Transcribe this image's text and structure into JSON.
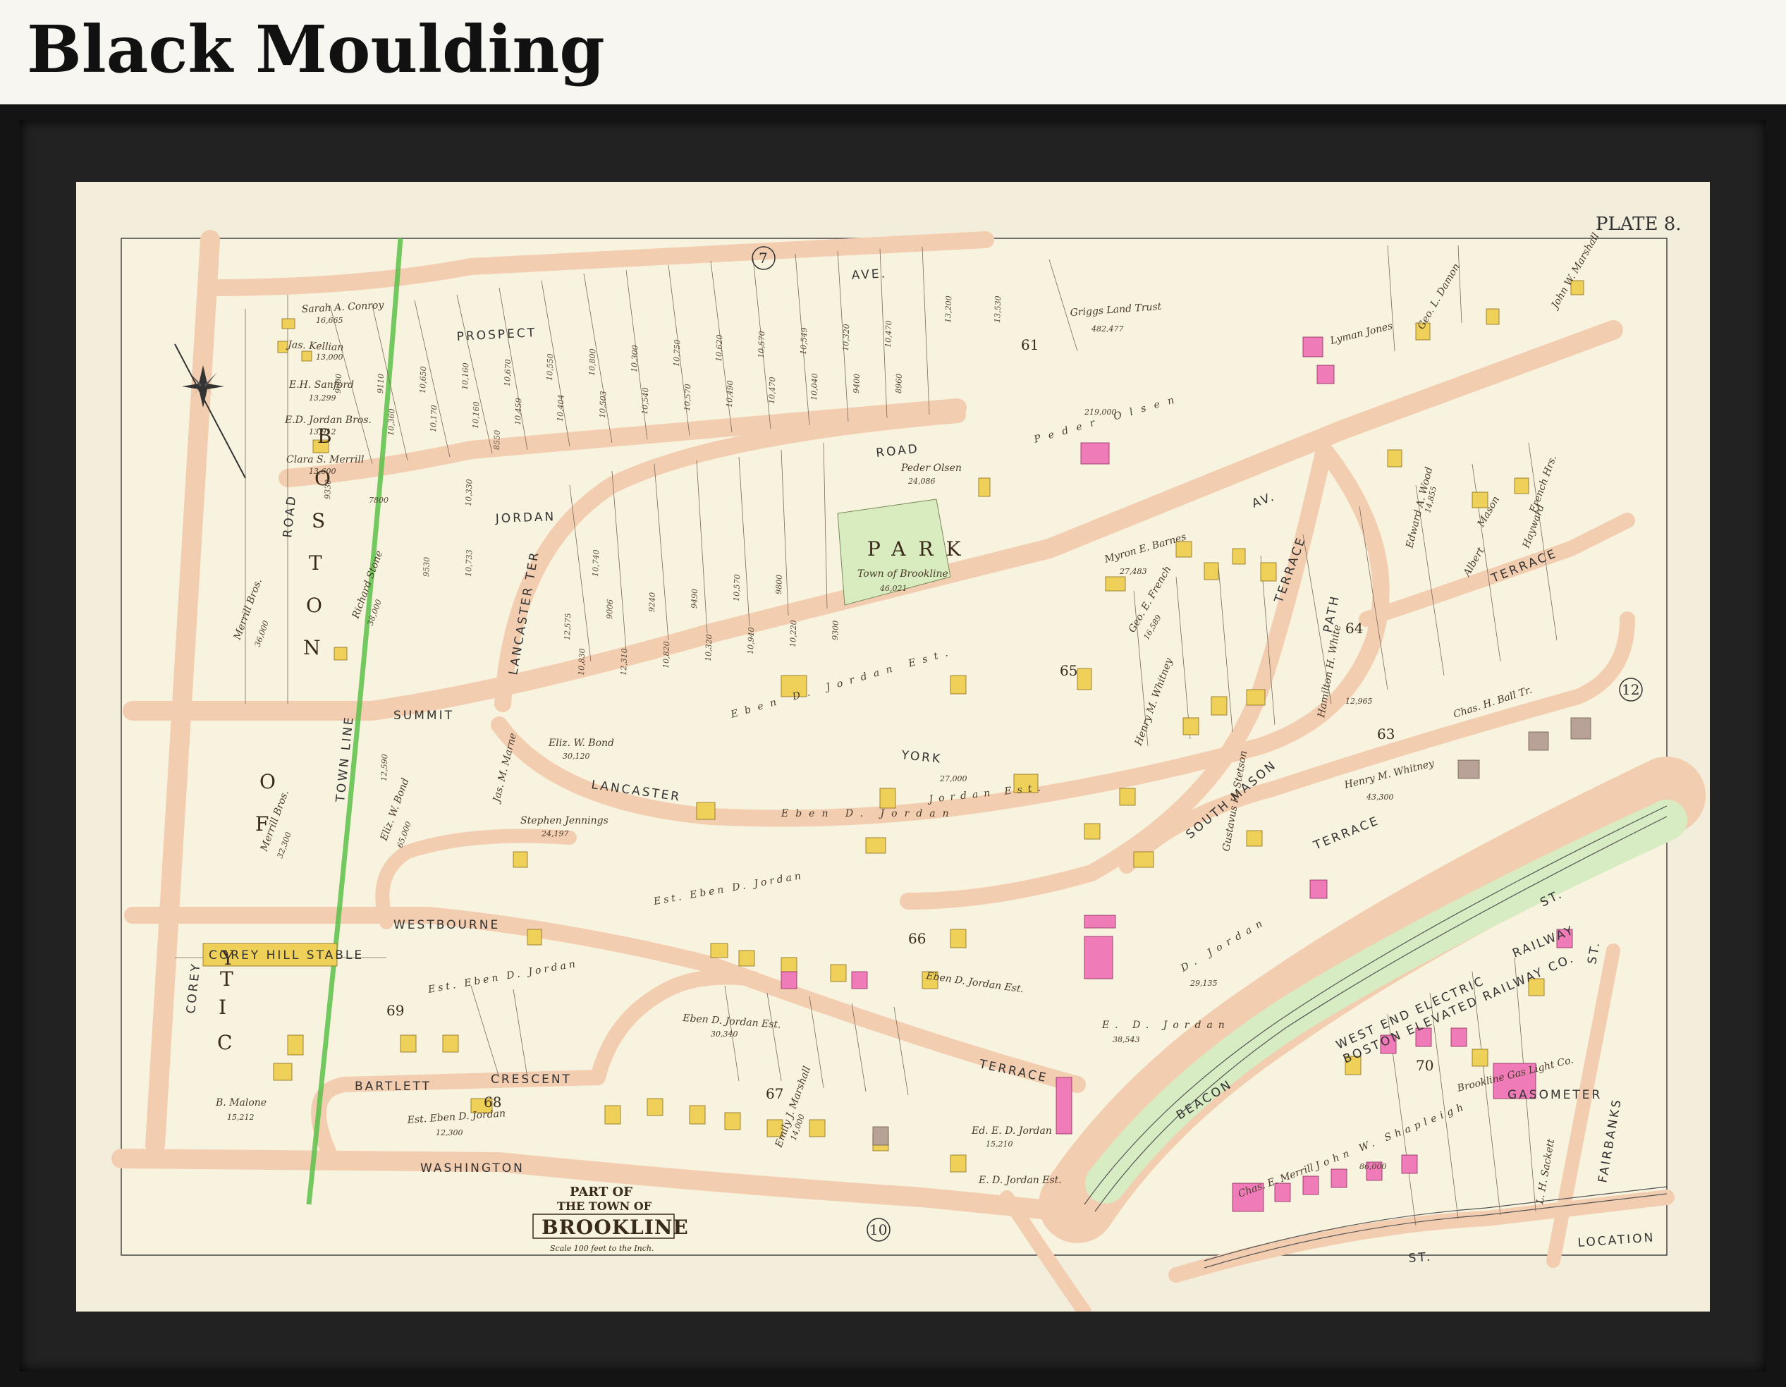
{
  "header": {
    "title": "Black Moulding"
  },
  "map": {
    "plate": "PLATE 8.",
    "plate_refs": [
      "7",
      "10",
      "12"
    ],
    "cartouche": {
      "line1": "PART OF",
      "line2": "THE TOWN OF",
      "line3": "BROOKLINE",
      "scale": "Scale 100 feet to the Inch."
    },
    "streets": {
      "prospect": "PROSPECT",
      "ave": "AVE.",
      "road": "ROAD",
      "jordan": "JORDAN",
      "boston_road": "ROAD",
      "lancaster_ter": "LANCASTER TER",
      "summit": "SUMMIT",
      "lancaster": "LANCASTER",
      "york": "YORK",
      "westbourne": "WESTBOURNE",
      "bartlett": "BARTLETT",
      "crescent": "CRESCENT",
      "washington": "WASHINGTON",
      "terrace_mid": "TERRACE",
      "terrace_diag": "TERRACE",
      "terrace_right": "TERRACE",
      "south_mason": "SOUTH MASON",
      "terrace_sm": "TERRACE",
      "av": "AV.",
      "beacon": "BEACON",
      "st_beacon": "ST.",
      "st_bottom": "ST.",
      "fairbanks": "FAIRBANKS",
      "st_fair": "ST.",
      "corey": "COREY",
      "path": "PATH"
    },
    "region_letters": {
      "boston": [
        "B",
        "O",
        "S",
        "T",
        "O",
        "N"
      ],
      "city_of": [
        "O",
        "F"
      ],
      "city": [
        "C",
        "I",
        "T",
        "Y"
      ]
    },
    "town_line": "TOWN LINE",
    "park": {
      "name": "PARK",
      "owner": "Town of Brookline",
      "area": "46,021"
    },
    "blocks": [
      "61",
      "63",
      "64",
      "65",
      "66",
      "67",
      "68",
      "69",
      "70"
    ],
    "owners": {
      "griggs": "Griggs Land Trust",
      "griggs_area": "482,477",
      "peder": "Peder Olsen",
      "peder_area": "219,000",
      "peder2": "Peder Olsen",
      "peder2_area": "24,086",
      "sarah": "Sarah A. Conroy",
      "sarah_area": "16,665",
      "kellian": "Jas. Kellian",
      "kellian_area": "13,000",
      "sanford": "E.H. Sanford",
      "sanford_area": "13,299",
      "jordan_bros": "E.D. Jordan Bros.",
      "jordan_bros_area": "13,912",
      "merrill_c": "Clara S. Merrill",
      "merrill_c_area": "13,600",
      "merrill_bros": "Merrill Bros.",
      "merrill_bros_area": "36,000",
      "merrill_bros2": "Merrill Bros.",
      "merrill_bros2_area": "32,300",
      "stone": "Richard Stone",
      "stone_area": "38,000",
      "bond": "Eliz. W. Bond",
      "bond_area": "30,120",
      "bond2": "Eliz. W. Bond",
      "bond2_area": "65,000",
      "eben_jordan_est": "Eben D. Jordan Est.",
      "eben_jordan": "Eben D. Jordan",
      "jordan_est": "Jordan Est.",
      "jordan_est_area": "27,000",
      "est_eben": "Est. Eben D. Jordan",
      "est_eben2": "Est. Eben D. Jordan",
      "est_eben3": "Est. Eben D. Jordan",
      "est_eben3_area": "12,300",
      "eben_est_66": "Eben D. Jordan Est.",
      "eben_est_67": "Eben D. Jordan Est.",
      "eben_est_67_area": "30,340",
      "ed_jordan": "E. D. Jordan",
      "ed_jordan_area": "38,543",
      "d_jordan": "D. Jordan",
      "d_jordan_area": "29,135",
      "jennings": "Stephen Jennings",
      "jennings_area": "24,197",
      "marne": "Jas. M. Marne",
      "myron": "Myron E. Barnes",
      "myron_area": "27,483",
      "french": "Geo. E. French",
      "french_area": "16,589",
      "whitney": "Henry M. Whitney",
      "whitney_area": "43,300",
      "whitney2": "Henry M. Whitney",
      "ball": "Chas. H. Ball Tr.",
      "mason": "Mason",
      "albert": "Albert",
      "wood": "Edward A. Wood",
      "wood_area": "14,855",
      "white": "Hamilton H. White",
      "white_area": "12,965",
      "shapleigh": "John W. Shapleigh",
      "shapleigh_area": "86,000",
      "brookline_gas": "Brookline Gas Light Co.",
      "gasometer": "GASOMETER",
      "corey_stable": "COREY HILL STABLE",
      "malone": "B. Malone",
      "malone_area": "15,212",
      "lyman": "Lyman Jones",
      "damon": "Geo. L. Damon",
      "marshall": "John W. Marshall",
      "french_hrs": "French Hrs.",
      "hayward": "Hayward",
      "merrill_chas": "Chas. E. Merrill",
      "jordan_ed": "Ed. E. D. Jordan",
      "jordan_ed_area": "15,210",
      "jordan_est_bottom": "E. D. Jordan Est.",
      "stetson": "Gustavus H. Stetson",
      "marshall_e": "Emily J. Marshall",
      "marshall_e_area": "14,000",
      "sackett": "L. H. Sackett"
    },
    "railway": {
      "line1": "WEST END ELECTRIC",
      "line2": "BOSTON ELEVATED RAILWAY CO.",
      "line3": "RAILWAY",
      "line4": "LOCATION"
    },
    "lot_numbers": [
      "9000",
      "9110",
      "10,650",
      "10,160",
      "10,670",
      "10,550",
      "10,800",
      "10,300",
      "10,750",
      "10,620",
      "10,570",
      "10,549",
      "10,320",
      "10,470",
      "13,200",
      "13,530",
      "9330",
      "10,360",
      "10,170",
      "10,160",
      "10,459",
      "10,404",
      "10,503",
      "10,540",
      "10,570",
      "10,490",
      "10,470",
      "10,040",
      "9400",
      "8960",
      "7800",
      "9530",
      "10,733",
      "10,740",
      "12,575",
      "9006",
      "9240",
      "9490",
      "10,570",
      "9800",
      "12,590",
      "10,830",
      "12,310",
      "10,820",
      "10,320",
      "10,940",
      "10,220",
      "9300",
      "8550",
      "10,330"
    ]
  }
}
